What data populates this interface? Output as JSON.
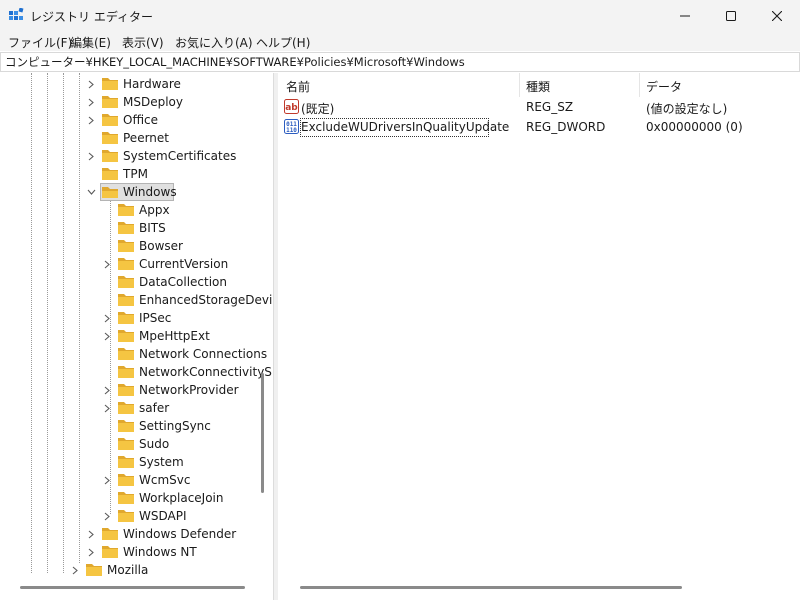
{
  "window": {
    "title": "レジストリ エディター"
  },
  "menu": [
    {
      "label": "ファイル(F)"
    },
    {
      "label": "編集(E)"
    },
    {
      "label": "表示(V)"
    },
    {
      "label": "お気に入り(A)"
    },
    {
      "label": "ヘルプ(H)"
    }
  ],
  "address": {
    "value": "コンピューター¥HKEY_LOCAL_MACHINE¥SOFTWARE¥Policies¥Microsoft¥Windows"
  },
  "tree": {
    "items": [
      {
        "label": "Hardware",
        "expandable": true
      },
      {
        "label": "MSDeploy",
        "expandable": true
      },
      {
        "label": "Office",
        "expandable": true
      },
      {
        "label": "Peernet",
        "expandable": false
      },
      {
        "label": "SystemCertificates",
        "expandable": true
      },
      {
        "label": "TPM",
        "expandable": false
      },
      {
        "label": "Windows",
        "expandable": true,
        "expanded": true,
        "selected": true
      },
      {
        "label": "Appx",
        "expandable": false
      },
      {
        "label": "BITS",
        "expandable": false
      },
      {
        "label": "Bowser",
        "expandable": false
      },
      {
        "label": "CurrentVersion",
        "expandable": true
      },
      {
        "label": "DataCollection",
        "expandable": false
      },
      {
        "label": "EnhancedStorageDevi",
        "expandable": false
      },
      {
        "label": "IPSec",
        "expandable": true
      },
      {
        "label": "MpeHttpExt",
        "expandable": true
      },
      {
        "label": "Network Connections",
        "expandable": false
      },
      {
        "label": "NetworkConnectivityS",
        "expandable": false
      },
      {
        "label": "NetworkProvider",
        "expandable": true
      },
      {
        "label": "safer",
        "expandable": true
      },
      {
        "label": "SettingSync",
        "expandable": false
      },
      {
        "label": "Sudo",
        "expandable": false
      },
      {
        "label": "System",
        "expandable": false
      },
      {
        "label": "WcmSvc",
        "expandable": true
      },
      {
        "label": "WorkplaceJoin",
        "expandable": false
      },
      {
        "label": "WSDAPI",
        "expandable": true
      },
      {
        "label": "Windows Defender",
        "expandable": true
      },
      {
        "label": "Windows NT",
        "expandable": true
      },
      {
        "label": "Mozilla",
        "expandable": true
      }
    ]
  },
  "list": {
    "columns": {
      "name": "名前",
      "type": "種類",
      "data": "データ"
    },
    "rows": [
      {
        "name": "(既定)",
        "type": "REG_SZ",
        "data": "(値の設定なし)",
        "icon": "string-value-icon"
      },
      {
        "name": "ExcludeWUDriversInQualityUpdate",
        "type": "REG_DWORD",
        "data": "0x00000000 (0)",
        "icon": "binary-value-icon"
      }
    ]
  },
  "colors": {
    "folder": "#f5c542",
    "folder_dark": "#e0a82e",
    "selection": "#e0e0e0"
  }
}
